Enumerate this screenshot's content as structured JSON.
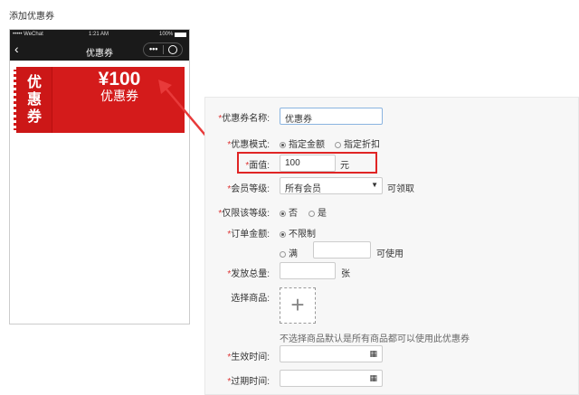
{
  "page_title": "添加优惠券",
  "phone": {
    "carrier": "••••• WeChat",
    "time": "1:21 AM",
    "battery": "100%",
    "nav_title": "优惠券",
    "back_icon": "chevron-left-icon",
    "more_icon": "more-dots-icon",
    "close_icon": "target-circle-icon"
  },
  "coupon": {
    "side_label": "优惠券",
    "amount": "¥100",
    "label": "优惠券",
    "color": "#d41b1b"
  },
  "form": {
    "name": {
      "label": "优惠券名称:",
      "value": "优惠券"
    },
    "mode": {
      "label": "优惠模式:",
      "options": [
        "指定金额",
        "指定折扣"
      ],
      "selected": 0
    },
    "face": {
      "label": "面值:",
      "value": "100",
      "unit": "元"
    },
    "member": {
      "label": "会员等级:",
      "value": "所有会员",
      "suffix": "可领取"
    },
    "restrict": {
      "label": "仅限该等级:",
      "options": [
        "否",
        "是"
      ],
      "selected": 0
    },
    "order": {
      "label": "订单金额:",
      "opt1": "不限制",
      "opt2": "满",
      "suffix": "可使用",
      "value": ""
    },
    "qty": {
      "label": "发放总量:",
      "unit": "张",
      "value": ""
    },
    "goods": {
      "label": "选择商品:",
      "hint": "不选择商品默认是所有商品都可以使用此优惠券"
    },
    "start": {
      "label": "生效时间:",
      "value": ""
    },
    "end": {
      "label": "过期时间:",
      "value": ""
    }
  },
  "highlight_color": "#e02424"
}
